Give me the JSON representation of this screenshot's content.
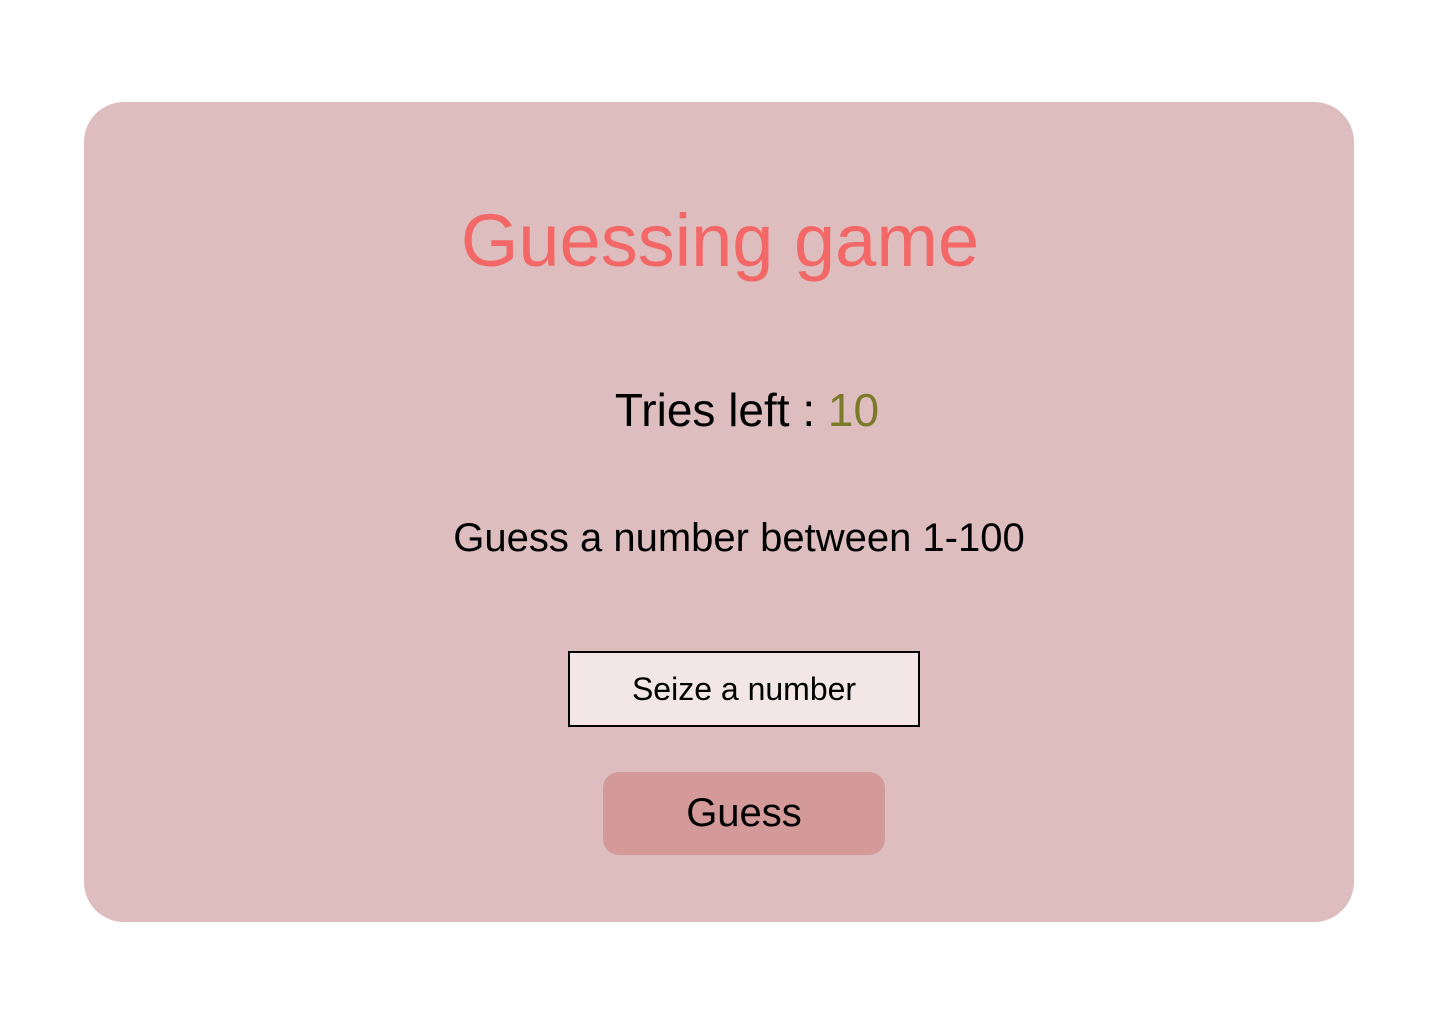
{
  "game": {
    "title": "Guessing game",
    "tries_label": "Tries left : ",
    "tries_count": "10",
    "prompt": "Guess a number between 1-100",
    "input_placeholder": "Seize a number",
    "input_value": "",
    "guess_button_label": "Guess"
  },
  "colors": {
    "page_background": "#ffffff",
    "card_background": "#ddbdbe",
    "title": "#f36767",
    "tries_count": "#7a7a2a",
    "input_background": "#f2e6e6",
    "button_background": "#d39a99"
  }
}
